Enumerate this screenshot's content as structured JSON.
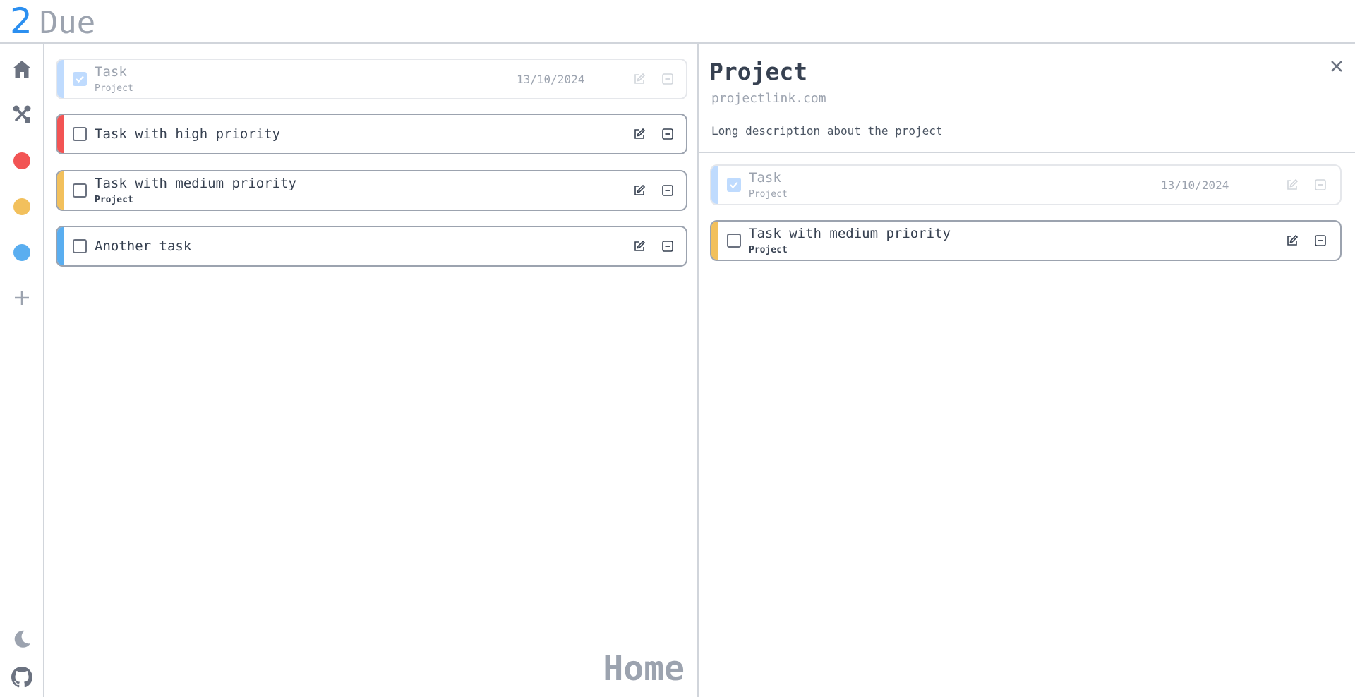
{
  "app": {
    "logo_number": "2",
    "logo_text": "Due"
  },
  "sidebar": {
    "items": [
      {
        "name": "home",
        "icon": "home-icon"
      },
      {
        "name": "tools",
        "icon": "tools-icon"
      },
      {
        "name": "high-priority",
        "color": "#f25454"
      },
      {
        "name": "medium-priority",
        "color": "#f2c05c"
      },
      {
        "name": "low-priority",
        "color": "#5aaef0"
      },
      {
        "name": "add",
        "icon": "plus-icon"
      }
    ],
    "bottom": [
      {
        "name": "theme",
        "icon": "moon-icon"
      },
      {
        "name": "github",
        "icon": "github-icon"
      }
    ]
  },
  "main": {
    "page_label": "Home",
    "tasks": [
      {
        "title": "Task",
        "project": "Project",
        "date": "13/10/2024",
        "done": true,
        "color": "#bfdbfe"
      },
      {
        "title": "Task with high priority",
        "project": "",
        "date": "",
        "done": false,
        "color": "#f25454"
      },
      {
        "title": "Task with medium priority",
        "project": "Project",
        "date": "",
        "done": false,
        "color": "#f2c05c"
      },
      {
        "title": "Another task",
        "project": "",
        "date": "",
        "done": false,
        "color": "#5aaef0"
      }
    ]
  },
  "panel": {
    "title": "Project",
    "link": "projectlink.com",
    "description": "Long description about the project",
    "tasks": [
      {
        "title": "Task",
        "project": "Project",
        "date": "13/10/2024",
        "done": true,
        "color": "#bfdbfe"
      },
      {
        "title": "Task with medium priority",
        "project": "Project",
        "date": "",
        "done": false,
        "color": "#f2c05c"
      }
    ]
  }
}
